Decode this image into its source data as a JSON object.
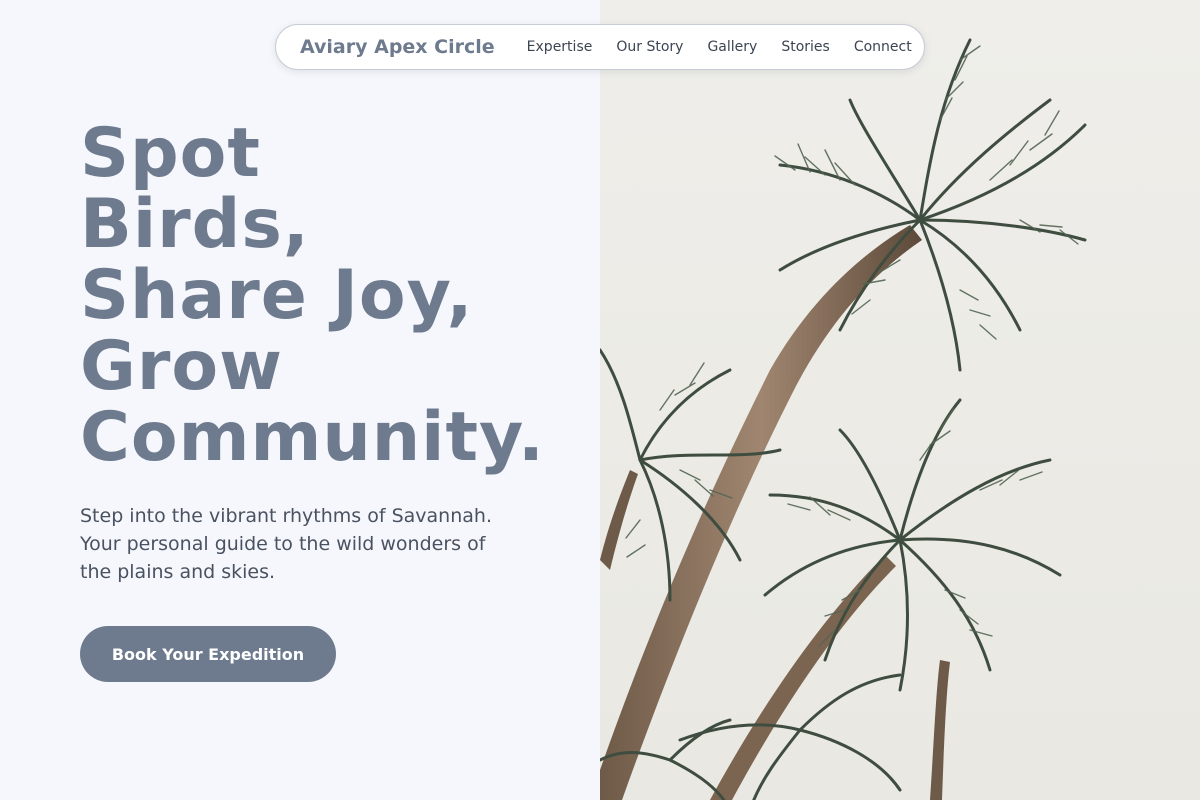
{
  "nav": {
    "brand": "Aviary Apex Circle",
    "links": [
      "Expertise",
      "Our Story",
      "Gallery",
      "Stories",
      "Connect"
    ]
  },
  "hero": {
    "title_lines": [
      "Spot",
      "Birds,",
      "Share Joy,",
      "Grow",
      "Community."
    ],
    "subtitle_lines": [
      "Step into the vibrant rhythms of Savannah.",
      "Your personal guide to the wild wonders of",
      "the plains and skies."
    ],
    "cta_label": "Book Your Expedition"
  },
  "image": {
    "subject": "palm-trees-photo"
  },
  "colors": {
    "accent": "#6e7b8e",
    "background": "#f6f7fc",
    "body_text": "#495260"
  }
}
